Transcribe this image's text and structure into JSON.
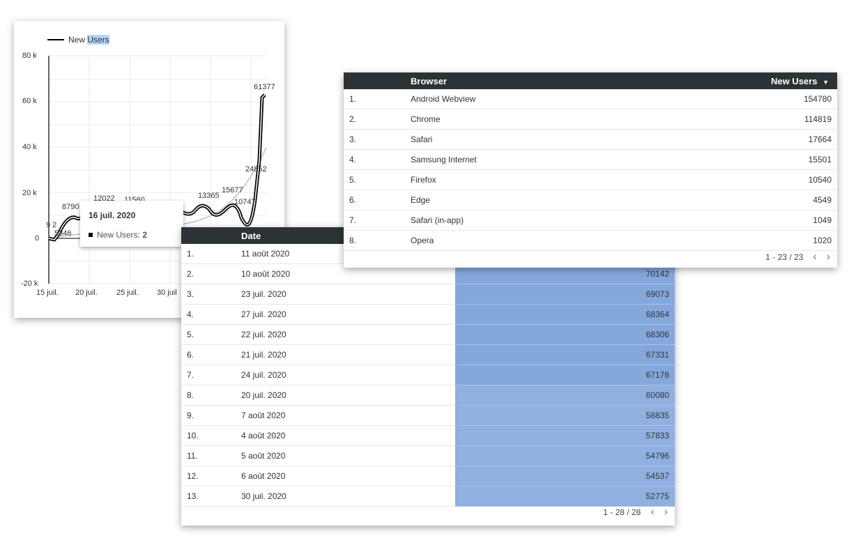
{
  "chart": {
    "legend_label_prefix": "New ",
    "legend_label_highlight": "Users",
    "y_ticks": [
      "80 k",
      "60 k",
      "40 k",
      "20 k",
      "0",
      "-20 k"
    ],
    "x_ticks": [
      "15 juil.",
      "20 juil.",
      "25 juil.",
      "30 juil"
    ],
    "data_labels": [
      "61377",
      "24852",
      "15677",
      "13365",
      "12022",
      "11560",
      "10747",
      "9 2",
      "5346",
      "8790"
    ],
    "tooltip": {
      "title": "16 juil. 2020",
      "series_label": "New Users: ",
      "value": "2"
    }
  },
  "chart_data": {
    "type": "line",
    "series": [
      {
        "name": "New Users",
        "color": "#000000"
      }
    ],
    "ylim": [
      -20000,
      80000
    ],
    "x_ticks": [
      "15 juil.",
      "20 juil.",
      "25 juil.",
      "30 juil"
    ],
    "y_ticks": [
      "80 k",
      "60 k",
      "40 k",
      "20 k",
      "0",
      "-20 k"
    ],
    "grid": true,
    "legend": "top-left",
    "annotated_points": [
      {
        "x": "14 juil.",
        "y": 0
      },
      {
        "x": "16 juil.",
        "y": 2
      },
      {
        "x": "17 juil.",
        "y": 5346
      },
      {
        "x": "18 juil.",
        "y": 8790
      },
      {
        "x": "19 juil.",
        "y": 12022
      },
      {
        "x": "21 juil.",
        "y": 11560
      },
      {
        "x": "24 juil.",
        "y": 12000
      },
      {
        "x": "27 juil.",
        "y": 13365
      },
      {
        "x": "31 juil.",
        "y": 15677
      },
      {
        "x": "1 août",
        "y": 10747
      },
      {
        "x": "2 août",
        "y": 24852
      },
      {
        "x": "3 août",
        "y": 61377
      }
    ]
  },
  "date_table": {
    "header_date": "Date",
    "rows": [
      {
        "idx": "1.",
        "date": "11 août 2020",
        "value": ""
      },
      {
        "idx": "2.",
        "date": "10 août 2020",
        "value": "70142"
      },
      {
        "idx": "3.",
        "date": "23 juil. 2020",
        "value": "69073"
      },
      {
        "idx": "4.",
        "date": "27 juil. 2020",
        "value": "68364"
      },
      {
        "idx": "5.",
        "date": "22 juil. 2020",
        "value": "68306"
      },
      {
        "idx": "6.",
        "date": "21 juil. 2020",
        "value": "67331"
      },
      {
        "idx": "7.",
        "date": "24 juil. 2020",
        "value": "67178"
      },
      {
        "idx": "8.",
        "date": "20 juil. 2020",
        "value": "60080"
      },
      {
        "idx": "9.",
        "date": "7 août 2020",
        "value": "58835"
      },
      {
        "idx": "10.",
        "date": "4 août 2020",
        "value": "57833"
      },
      {
        "idx": "11.",
        "date": "5 août 2020",
        "value": "54796"
      },
      {
        "idx": "12.",
        "date": "6 août 2020",
        "value": "54537"
      },
      {
        "idx": "13.",
        "date": "30 juil. 2020",
        "value": "52775"
      }
    ],
    "pager_text": "1 - 28 / 28"
  },
  "browser_table": {
    "header_browser": "Browser",
    "header_new_users": "New Users",
    "sort_icon": "▼",
    "rows": [
      {
        "idx": "1.",
        "browser": "Android Webview",
        "value": "154780"
      },
      {
        "idx": "2.",
        "browser": "Chrome",
        "value": "114819"
      },
      {
        "idx": "3.",
        "browser": "Safari",
        "value": "17664"
      },
      {
        "idx": "4.",
        "browser": "Samsung Internet",
        "value": "15501"
      },
      {
        "idx": "5.",
        "browser": "Firefox",
        "value": "10540"
      },
      {
        "idx": "6.",
        "browser": "Edge",
        "value": "4549"
      },
      {
        "idx": "7.",
        "browser": "Safari (in-app)",
        "value": "1049"
      },
      {
        "idx": "8.",
        "browser": "Opera",
        "value": "1020"
      }
    ],
    "pager_text": "1 - 23 / 23"
  },
  "icons": {
    "prev": "chevron-left-icon",
    "next": "chevron-right-icon"
  },
  "colors": {
    "header_bg": "#2b3336",
    "bar_fill": "#8fb0e0",
    "line": "#000000",
    "trend": "#cccccc"
  }
}
